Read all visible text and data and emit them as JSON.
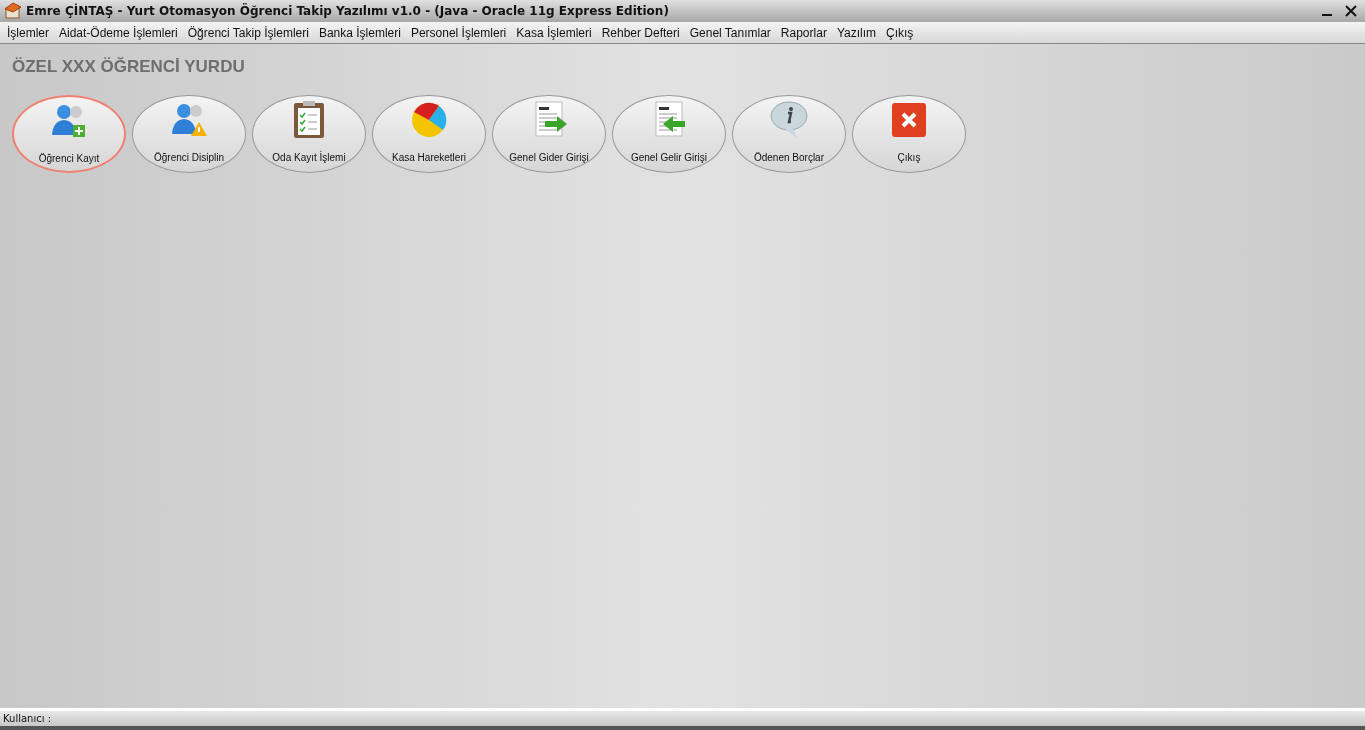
{
  "window": {
    "title": "Emre ÇİNTAŞ - Yurt Otomasyon Öğrenci Takip Yazılımı v1.0 - (Java - Oracle 11g Express Edition)"
  },
  "menu": [
    "İşlemler",
    "Aidat-Ödeme İşlemleri",
    "Öğrenci Takip İşlemleri",
    "Banka İşlemleri",
    "Personel İşlemleri",
    "Kasa İşlemleri",
    "Rehber Defteri",
    "Genel Tanımlar",
    "Raporlar",
    "Yazılım",
    "Çıkış"
  ],
  "heading": "ÖZEL XXX ÖĞRENCİ YURDU",
  "buttons": [
    {
      "label": "Öğrenci Kayıt",
      "kind": "user-add",
      "selected": true
    },
    {
      "label": "Öğrenci Disiplin",
      "kind": "user-warning",
      "selected": false
    },
    {
      "label": "Oda Kayıt İşlemi",
      "kind": "clipboard",
      "selected": false
    },
    {
      "label": "Kasa Hareketleri",
      "kind": "pie",
      "selected": false
    },
    {
      "label": "Genel Gider Girişi",
      "kind": "doc-out",
      "selected": false
    },
    {
      "label": "Genel Gelir Girişi",
      "kind": "doc-in",
      "selected": false
    },
    {
      "label": "Ödenen Borçlar",
      "kind": "info",
      "selected": false
    },
    {
      "label": "Çıkış",
      "kind": "exit",
      "selected": false
    }
  ],
  "status_bar": {
    "label": "Kullanıcı :"
  }
}
